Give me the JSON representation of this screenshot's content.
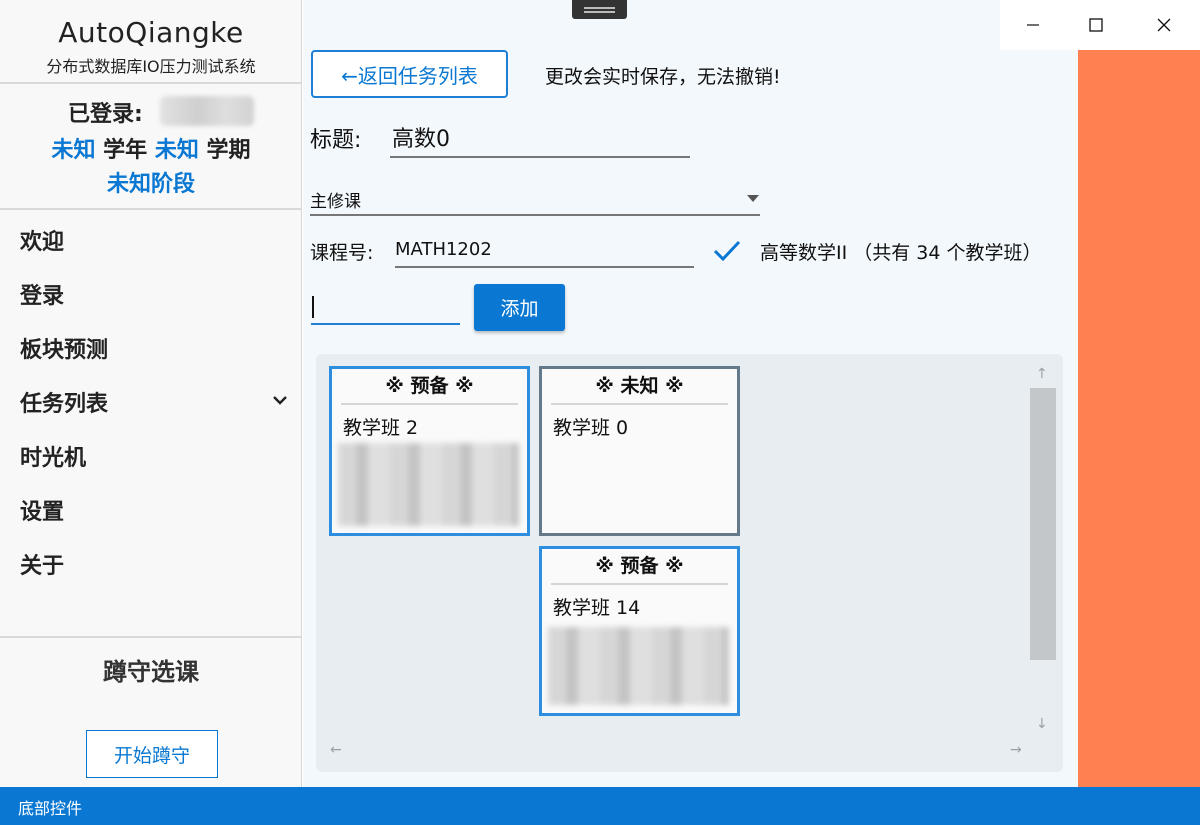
{
  "app": {
    "title": "AutoQiangke",
    "subtitle": "分布式数据库IO压力测试系统"
  },
  "user": {
    "logged_in_label": "已登录:",
    "year": "未知",
    "year_suffix": "学年",
    "term": "未知",
    "term_suffix": "学期",
    "stage": "未知阶段"
  },
  "nav": {
    "items": [
      {
        "label": "欢迎"
      },
      {
        "label": "登录"
      },
      {
        "label": "板块预测"
      },
      {
        "label": "任务列表"
      },
      {
        "label": "时光机"
      },
      {
        "label": "设置"
      },
      {
        "label": "关于"
      }
    ]
  },
  "panel": {
    "title": "蹲守选课",
    "start_button": "开始蹲守"
  },
  "toolbar": {
    "back_button": "←返回任务列表",
    "notice": "更改会实时保存，无法撤销!"
  },
  "form": {
    "title_label": "标题:",
    "title_value": "高数0",
    "type_value": "主修课",
    "course_label": "课程号:",
    "course_value": "MATH1202",
    "course_info": "高等数学II （共有 34 个教学班）",
    "class_input_value": "",
    "add_button": "添加"
  },
  "cards": [
    {
      "status": "※ 预备 ※",
      "name": "教学班 2"
    },
    {
      "status": "※ 未知 ※",
      "name": "教学班 0"
    },
    {
      "status": "※ 预备 ※",
      "name": "教学班 14"
    }
  ],
  "statusbar": {
    "text": "底部控件"
  },
  "colors": {
    "accent": "#0a78d2",
    "accent_strip": "#ff8151",
    "card_border_ready": "#2d8ee0",
    "card_border_unknown": "#647a8a"
  }
}
